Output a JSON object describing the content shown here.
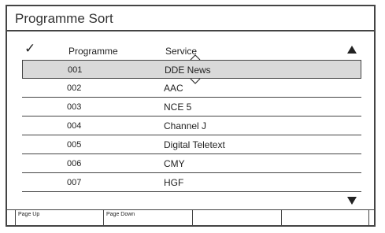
{
  "title": "Programme Sort",
  "header": {
    "check": "✓",
    "programme": "Programme",
    "service": "Service"
  },
  "rows": [
    {
      "num": "001",
      "service": "DDE News",
      "selected": true
    },
    {
      "num": "002",
      "service": "AAC"
    },
    {
      "num": "003",
      "service": "NCE 5"
    },
    {
      "num": "004",
      "service": "Channel J"
    },
    {
      "num": "005",
      "service": "Digital Teletext"
    },
    {
      "num": "006",
      "service": "CMY"
    },
    {
      "num": "007",
      "service": "HGF"
    }
  ],
  "fkeys": [
    "Page Up",
    "Page Down",
    "",
    ""
  ],
  "icons": {
    "scroll_up": "triangle-up-icon",
    "scroll_down": "triangle-down-icon",
    "check": "checkmark-icon"
  }
}
